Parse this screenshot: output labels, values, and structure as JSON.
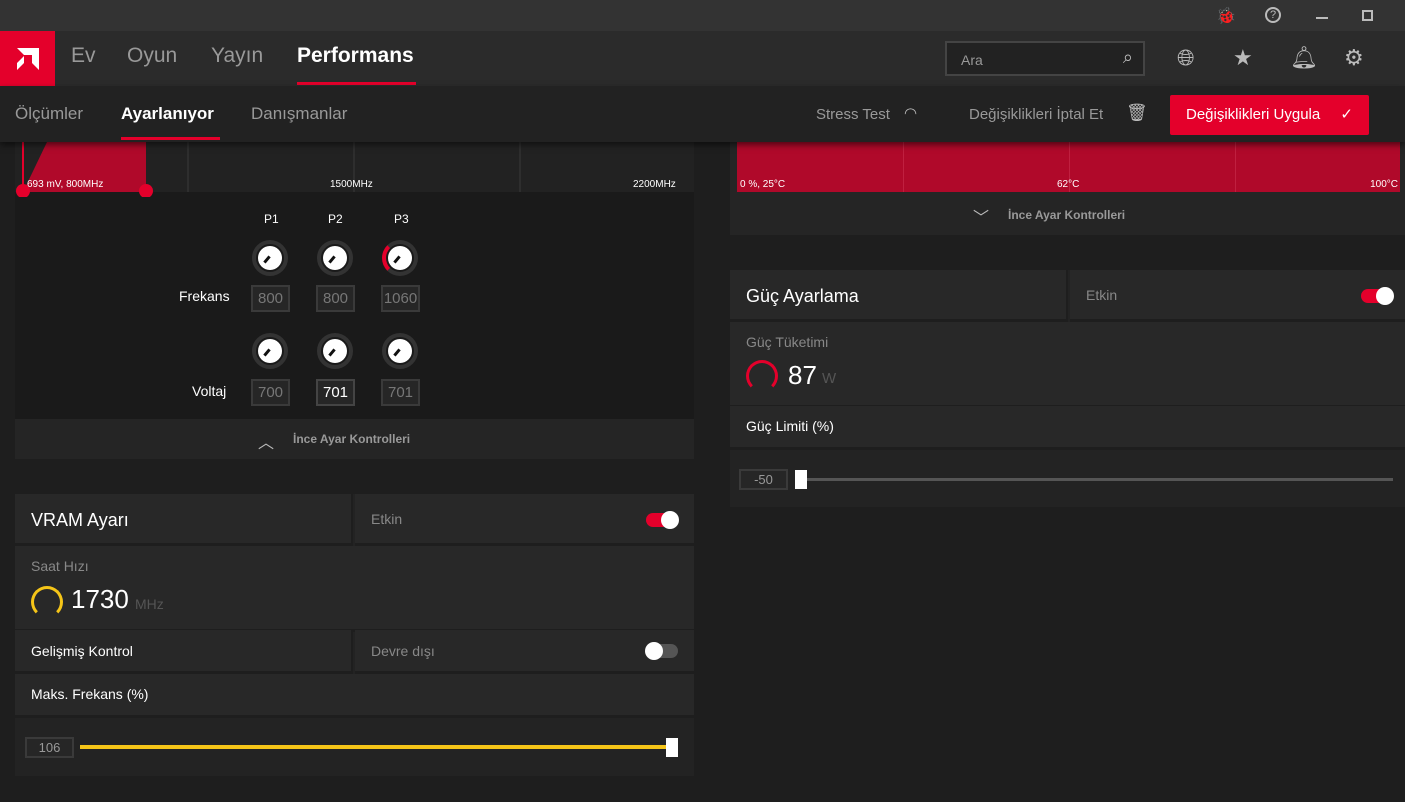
{
  "titlebar": {
    "icons": [
      "bug-icon",
      "help-icon",
      "minimize-icon",
      "restore-icon"
    ]
  },
  "nav": {
    "tabs": [
      "Ev",
      "Oyun",
      "Yayın",
      "Performans"
    ],
    "active": "Performans",
    "search_placeholder": "Ara"
  },
  "subnav": {
    "tabs": [
      "Ölçümler",
      "Ayarlanıyor",
      "Danışmanlar"
    ],
    "active": "Ayarlanıyor",
    "stress_test": "Stress Test",
    "discard": "Değişiklikleri İptal Et",
    "apply": "Değişiklikleri Uygula"
  },
  "gpu_tuning": {
    "chart_labels": {
      "start": "693 mV, 800MHz",
      "mid": "1500MHz",
      "end": "2200MHz"
    },
    "states": [
      "P1",
      "P2",
      "P3"
    ],
    "freq_label": "Frekans",
    "volt_label": "Voltaj",
    "frequency": [
      "800",
      "800",
      "1060"
    ],
    "voltage": [
      "700",
      "701",
      "701"
    ],
    "footer": "İnce Ayar Kontrolleri"
  },
  "vram": {
    "title": "VRAM Ayarı",
    "status": "Etkin",
    "enabled": true,
    "clock_label": "Saat Hızı",
    "clock_value": "1730",
    "clock_unit": "MHz",
    "advanced_label": "Gelişmiş Kontrol",
    "advanced_status": "Devre dışı",
    "advanced_enabled": false,
    "max_freq_label": "Maks. Frekans (%)",
    "max_freq_value": "106",
    "max_freq_fraction": 1.0
  },
  "fan": {
    "labels": {
      "start": "0 %, 25°C",
      "mid": "62°C",
      "end": "100°C"
    },
    "footer": "İnce Ayar Kontrolleri"
  },
  "power": {
    "title": "Güç Ayarlama",
    "status": "Etkin",
    "enabled": true,
    "usage_label": "Güç Tüketimi",
    "usage_value": "87",
    "usage_unit": "W",
    "limit_label": "Güç Limiti (%)",
    "limit_value": "-50",
    "limit_fraction": 0.0
  },
  "colors": {
    "accent": "#e4002b",
    "vram": "#f5c518"
  }
}
